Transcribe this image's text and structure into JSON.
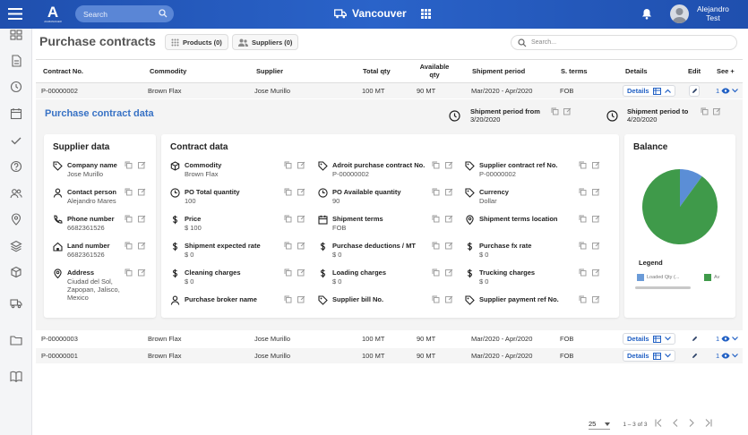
{
  "app": {
    "logo_letter": "A",
    "logo_sub": "AGMANAGER",
    "search_placeholder": "Search",
    "city": "Vancouver",
    "user_first": "Alejandro",
    "user_last": "Test"
  },
  "page": {
    "title": "Purchase contracts",
    "chip_products": "Products (0)",
    "chip_suppliers": "Suppliers (0)",
    "search_placeholder": "Search..."
  },
  "table": {
    "headers": [
      "Contract No.",
      "Commodity",
      "Supplier",
      "Total qty",
      "Available qty",
      "Shipment period",
      "S. terms",
      "Details",
      "Edit",
      "See +"
    ],
    "details_label": "Details",
    "seeplus_count": "1",
    "rows": [
      {
        "contract": "P-00000002",
        "commodity": "Brown Flax",
        "supplier": "Jose Murillo",
        "total": "100 MT",
        "available": "90 MT",
        "period": "Mar/2020 - Apr/2020",
        "terms": "FOB"
      },
      {
        "contract": "P-00000003",
        "commodity": "Brown Flax",
        "supplier": "Jose Murillo",
        "total": "100 MT",
        "available": "90 MT",
        "period": "Mar/2020 - Apr/2020",
        "terms": "FOB"
      },
      {
        "contract": "P-00000001",
        "commodity": "Brown Flax",
        "supplier": "Jose Murillo",
        "total": "100 MT",
        "available": "90 MT",
        "period": "Mar/2020 - Apr/2020",
        "terms": "FOB"
      }
    ]
  },
  "detail": {
    "title": "Purchase contract data",
    "ship_from_label": "Shipment period from",
    "ship_from_value": "3/20/2020",
    "ship_to_label": "Shipment period to",
    "ship_to_value": "4/20/2020",
    "supplier": {
      "title": "Supplier data",
      "fields": [
        {
          "label": "Company name",
          "value": "Jose Murillo",
          "icon": "tag-icon"
        },
        {
          "label": "Contact person",
          "value": "Alejandro Mares",
          "icon": "person-icon"
        },
        {
          "label": "Phone number",
          "value": "6682361526",
          "icon": "phone-icon"
        },
        {
          "label": "Land number",
          "value": "6682361526",
          "icon": "home-icon"
        },
        {
          "label": "Address",
          "value": "Ciudad del Sol,\nZapopan, Jalisco,\nMexico",
          "icon": "location-icon"
        }
      ]
    },
    "contract": {
      "title": "Contract data",
      "fields": [
        {
          "label": "Commodity",
          "value": "Brown Flax",
          "icon": "cube-icon"
        },
        {
          "label": "Adroit purchase contract No.",
          "value": "P-00000002",
          "icon": "tag-icon"
        },
        {
          "label": "Supplier contract ref No.",
          "value": "P-00000002",
          "icon": "tag-icon"
        },
        {
          "label": "PO Total quantity",
          "value": "100",
          "icon": "clock-icon"
        },
        {
          "label": "PO Available quantity",
          "value": "90",
          "icon": "clock-icon"
        },
        {
          "label": "Currency",
          "value": "Dollar",
          "icon": "tag-icon"
        },
        {
          "label": "Price",
          "value": "$ 100",
          "icon": "dollar-icon"
        },
        {
          "label": "Shipment terms",
          "value": "FOB",
          "icon": "calendar-icon"
        },
        {
          "label": "Shipment terms location",
          "value": "",
          "icon": "location-icon"
        },
        {
          "label": "Shipment expected rate",
          "value": "$ 0",
          "icon": "dollar-icon"
        },
        {
          "label": "Purchase deductions / MT",
          "value": "$ 0",
          "icon": "dollar-icon"
        },
        {
          "label": "Purchase fx rate",
          "value": "$ 0",
          "icon": "dollar-icon"
        },
        {
          "label": "Cleaning charges",
          "value": "$ 0",
          "icon": "dollar-icon"
        },
        {
          "label": "Loading charges",
          "value": "$ 0",
          "icon": "dollar-icon"
        },
        {
          "label": "Trucking charges",
          "value": "$ 0",
          "icon": "dollar-icon"
        },
        {
          "label": "Purchase broker name",
          "value": "",
          "icon": "person-icon"
        },
        {
          "label": "Supplier bill No.",
          "value": "",
          "icon": "tag-icon"
        },
        {
          "label": "Supplier payment ref No.",
          "value": "",
          "icon": "tag-icon"
        }
      ]
    },
    "balance": {
      "title": "Balance",
      "legend_title": "Legend",
      "legend": [
        {
          "name": "Loaded Qty (...",
          "color": "#6b9bd8"
        },
        {
          "name": "Av",
          "color": "#3f9a4a"
        }
      ],
      "slices": [
        {
          "name": "Loaded Qty",
          "value": 10,
          "color": "#5b8ed6"
        },
        {
          "name": "Available Qty",
          "value": 90,
          "color": "#3f9a4a"
        }
      ]
    }
  },
  "footer": {
    "page_size": "25",
    "range": "1 – 3 of 3"
  },
  "colors": {
    "header_blue": "#1f4fae",
    "accent": "#2160c4",
    "green": "#3f9a4a"
  }
}
